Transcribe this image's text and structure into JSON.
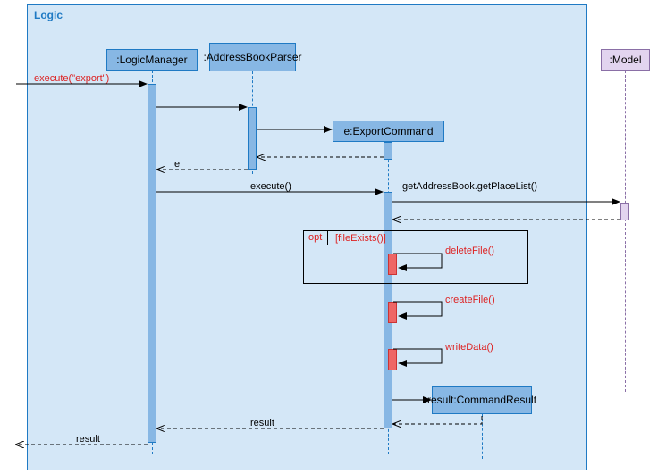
{
  "frame": {
    "label": "Logic"
  },
  "objects": {
    "logicManager": ":LogicManager",
    "parser": ":AddressBookParser",
    "exportCmd": "e:ExportCommand",
    "cmdResult": "result:CommandResult",
    "model": ":Model"
  },
  "messages": {
    "executeExport": "execute(\"export\")",
    "returnE": "e",
    "execute": "execute()",
    "getPlaceList": "getAddressBook.getPlaceList()",
    "fileExists": "[fileExists()]",
    "deleteFile": "deleteFile()",
    "createFile": "createFile()",
    "writeData": "writeData()",
    "returnResult": "result",
    "returnResult2": "result"
  },
  "fragments": {
    "opt": "opt"
  }
}
